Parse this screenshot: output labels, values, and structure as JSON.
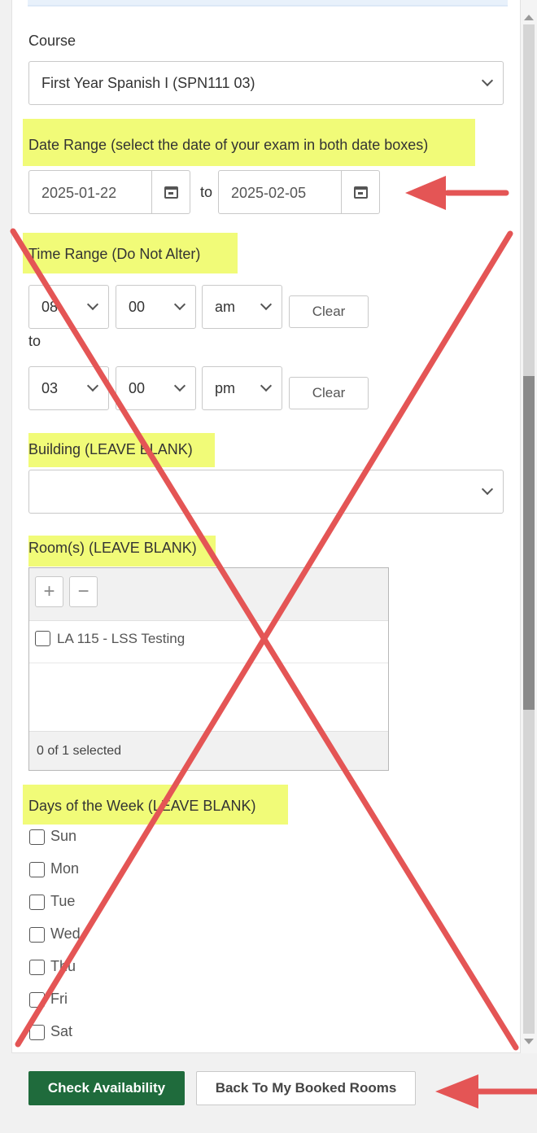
{
  "course": {
    "label": "Course",
    "value": "First Year Spanish I (SPN111 03)"
  },
  "date_range": {
    "label": "Date Range (select the date of your exam in both date boxes)",
    "start": "2025-01-22",
    "separator": "to",
    "end": "2025-02-05"
  },
  "time_range": {
    "label": "Time Range (Do Not Alter)",
    "start": {
      "hour": "08",
      "minute": "00",
      "ampm": "am"
    },
    "separator": "to",
    "end": {
      "hour": "03",
      "minute": "00",
      "ampm": "pm"
    },
    "clear_label": "Clear"
  },
  "building": {
    "label": "Building (LEAVE BLANK)",
    "value": ""
  },
  "rooms": {
    "label": "Room(s) (LEAVE BLANK)",
    "add_symbol": "+",
    "remove_symbol": "−",
    "items": [
      "LA 115 - LSS Testing"
    ],
    "selected_count": "0 of 1 selected"
  },
  "days": {
    "label": "Days of the Week (LEAVE BLANK)",
    "items": [
      "Sun",
      "Mon",
      "Tue",
      "Wed",
      "Thu",
      "Fri",
      "Sat"
    ]
  },
  "actions": {
    "check": "Check Availability",
    "back": "Back To My Booked Rooms"
  },
  "colors": {
    "highlight": "#f1fb78",
    "primary": "#1f6b3c",
    "annotation": "#e45555"
  }
}
